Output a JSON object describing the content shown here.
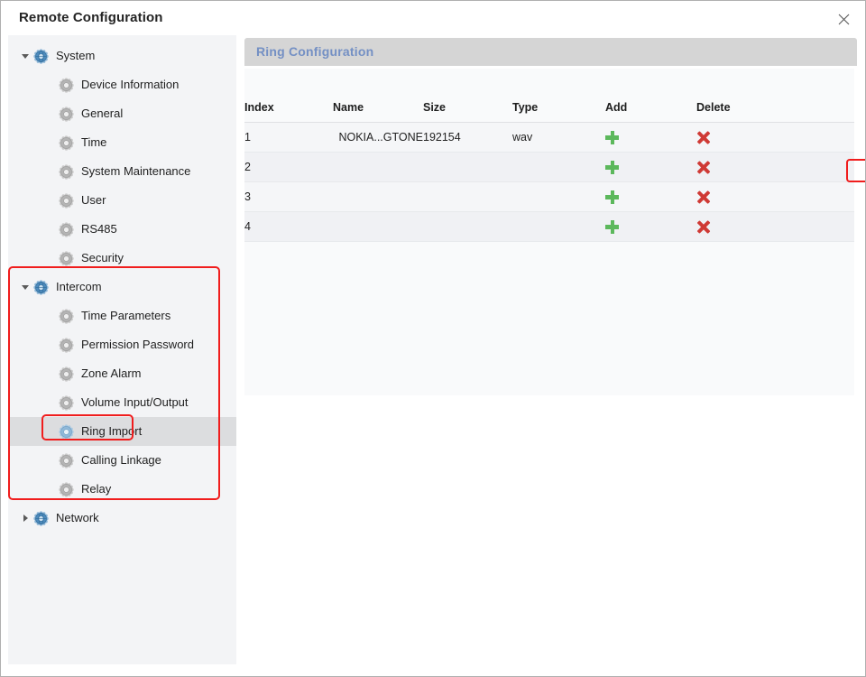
{
  "window": {
    "title": "Remote Configuration",
    "close_label": "✕",
    "close_icon": "close-icon"
  },
  "sidebar": {
    "nodes": [
      {
        "label": "System",
        "level": 0,
        "expanded": true,
        "icon": "globe-gear-icon",
        "selected": false
      },
      {
        "label": "Device Information",
        "level": 1,
        "expanded": null,
        "icon": "gear-icon",
        "selected": false
      },
      {
        "label": "General",
        "level": 1,
        "expanded": null,
        "icon": "gear-icon",
        "selected": false
      },
      {
        "label": "Time",
        "level": 1,
        "expanded": null,
        "icon": "gear-icon",
        "selected": false
      },
      {
        "label": "System Maintenance",
        "level": 1,
        "expanded": null,
        "icon": "gear-icon",
        "selected": false
      },
      {
        "label": "User",
        "level": 1,
        "expanded": null,
        "icon": "gear-icon",
        "selected": false
      },
      {
        "label": "RS485",
        "level": 1,
        "expanded": null,
        "icon": "gear-icon",
        "selected": false
      },
      {
        "label": "Security",
        "level": 1,
        "expanded": null,
        "icon": "gear-icon",
        "selected": false
      },
      {
        "label": "Intercom",
        "level": 0,
        "expanded": true,
        "icon": "globe-gear-icon",
        "selected": false
      },
      {
        "label": "Time Parameters",
        "level": 1,
        "expanded": null,
        "icon": "gear-icon",
        "selected": false
      },
      {
        "label": "Permission Password",
        "level": 1,
        "expanded": null,
        "icon": "gear-icon",
        "selected": false
      },
      {
        "label": "Zone Alarm",
        "level": 1,
        "expanded": null,
        "icon": "gear-icon",
        "selected": false
      },
      {
        "label": "Volume Input/Output",
        "level": 1,
        "expanded": null,
        "icon": "gear-icon",
        "selected": false
      },
      {
        "label": "Ring Import",
        "level": 1,
        "expanded": null,
        "icon": "gear-icon-active",
        "selected": true
      },
      {
        "label": "Calling Linkage",
        "level": 1,
        "expanded": null,
        "icon": "gear-icon",
        "selected": false
      },
      {
        "label": "Relay",
        "level": 1,
        "expanded": null,
        "icon": "gear-icon",
        "selected": false
      },
      {
        "label": "Network",
        "level": 0,
        "expanded": false,
        "icon": "globe-gear-icon",
        "selected": false
      }
    ]
  },
  "main": {
    "panel_title": "Ring Configuration",
    "table": {
      "columns": [
        "Index",
        "Name",
        "Size",
        "Type",
        "Add",
        "Delete"
      ],
      "rows": [
        {
          "index": "1",
          "name": "NOKIA...GTONE",
          "size": "192154",
          "type": "wav",
          "add": "add-icon",
          "delete": "delete-icon"
        },
        {
          "index": "2",
          "name": "",
          "size": "",
          "type": "",
          "add": "add-icon",
          "delete": "delete-icon"
        },
        {
          "index": "3",
          "name": "",
          "size": "",
          "type": "",
          "add": "add-icon",
          "delete": "delete-icon"
        },
        {
          "index": "4",
          "name": "",
          "size": "",
          "type": "",
          "add": "add-icon",
          "delete": "delete-icon"
        }
      ]
    }
  },
  "annotations": {
    "intercom_group": "Intercom section highlight",
    "ring_import_item": "Ring Import item highlight",
    "add_button_row1": "Add button highlight"
  },
  "colors": {
    "annotation_red": "#f01d1d",
    "panel_title_blue": "#7490c4",
    "add_green": "#5cb85c",
    "delete_red": "#cf3a35",
    "sidebar_bg": "#f3f4f6",
    "selected_row": "#dcdddf",
    "panel_header_bg": "#d5d5d5"
  }
}
